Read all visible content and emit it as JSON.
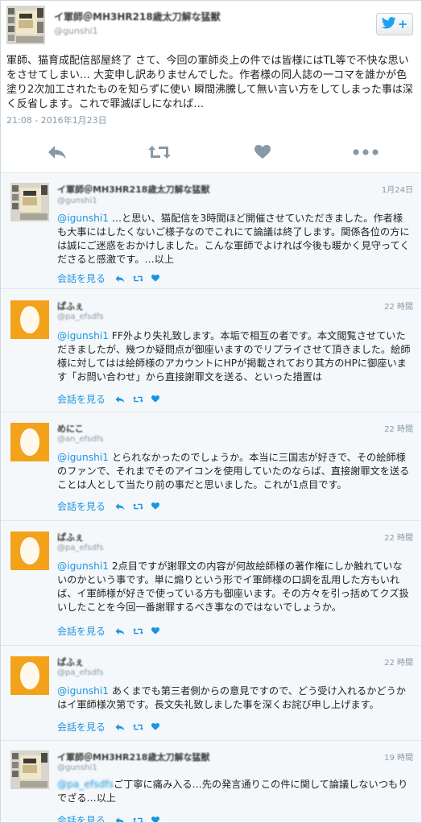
{
  "main_tweet": {
    "author_name": "イ軍師＠MH3HR218歳太刀解な猛獣",
    "author_handle": "@gunshi1",
    "follow_icon": "twitter-bird-icon",
    "follow_symbol": "+",
    "text": "軍師、猫育成配信部屋終了 さて、今回の軍師炎上の件では皆様にはTL等で不快な思いをさせてしまい… 大変申し訳ありませんでした。作者様の同人誌の一コマを誰かが色塗り2次加工されたものを知らずに使い 瞬間沸騰して無い言い方をしてしまった事は深く反省します。これで罪滅ぼしになれば…",
    "timestamp": "21:08 - 2016年1月23日",
    "actions": [
      "reply-icon",
      "retweet-icon",
      "like-icon",
      "more-icon"
    ]
  },
  "replies": [
    {
      "name": "イ軍師＠MH3HR218歳太刀解な猛獣",
      "handle": "@gunshi1",
      "time": "1月24日",
      "mention": "@igunshi1",
      "text": " …と思い、猫配信を3時間ほど開催させていただきました。作者様も大事にはしたくないご様子なのでこれにて論議は終了します。関係各位の方には誠にご迷惑をおかけしました。こんな軍師でよければ今後も暖かく見守ってくださると感激です。…以上",
      "conversation_label": "会話を見る",
      "avatar": "pixel"
    },
    {
      "name": "ぱふぇ",
      "handle": "@pa_efsdfs",
      "time": "22 時間",
      "mention": "@igunshi1",
      "text": " FF外より失礼致します。本垢で相互の者です。本文閲覧させていただきましたが、幾つか疑問点が御座いますのでリプライさせて頂きました。絵師様に対してはは絵師様のアカウントにHPが掲載されており其方のHPに御座います「お問い合わせ」から直接謝罪文を送る、といった措置は",
      "conversation_label": "会話を見る",
      "avatar": "orange"
    },
    {
      "name": "めにこ",
      "handle": "@an_efsdfs",
      "time": "22 時間",
      "mention": "@igunshi1",
      "text": " とられなかったのでしょうか。本当に三国志が好きで、その絵師様のファンで、それまでそのアイコンを使用していたのならば、直接謝罪文を送ることは人として当たり前の事だと思いました。これが1点目です。",
      "conversation_label": "会話を見る",
      "avatar": "orange"
    },
    {
      "name": "ぱふぇ",
      "handle": "@pa_efsdfs",
      "time": "22 時間",
      "mention": "@igunshi1",
      "text": " 2点目ですが謝罪文の内容が何故絵師様の著作権にしか触れていないのかという事です。単に煽りという形でイ軍師様の口調を乱用した方もいれば、イ軍師様が好きで使っている方も御座います。その方々を引っ括めてクズ扱いしたことを今回一番謝罪するべき事なのではないでしょうか。",
      "conversation_label": "会話を見る",
      "avatar": "orange"
    },
    {
      "name": "ぱふぇ",
      "handle": "@pa_efsdfs",
      "time": "22 時間",
      "mention": "@igunshi1",
      "text": " あくまでも第三者側からの意見ですので、どう受け入れるかどうかはイ軍師様次第です。長文失礼致しました事を深くお詫び申し上げます。",
      "conversation_label": "会話を見る",
      "avatar": "orange"
    },
    {
      "name": "イ軍師＠MH3HR218歳太刀解な猛獣",
      "handle": "@gunshi1",
      "time": "19 時間",
      "mention": "@pa_efsdfs",
      "text": "ご丁寧に痛み入る…先の発言通りこの件に関して論議しないつもりでざる…以上",
      "conversation_label": "会話を見る",
      "avatar": "pixel"
    }
  ],
  "colors": {
    "accent": "#1b95e0",
    "muted": "#8899a6",
    "reply_bg": "#f5f8fa",
    "avatar_orange": "#f3a21b"
  }
}
